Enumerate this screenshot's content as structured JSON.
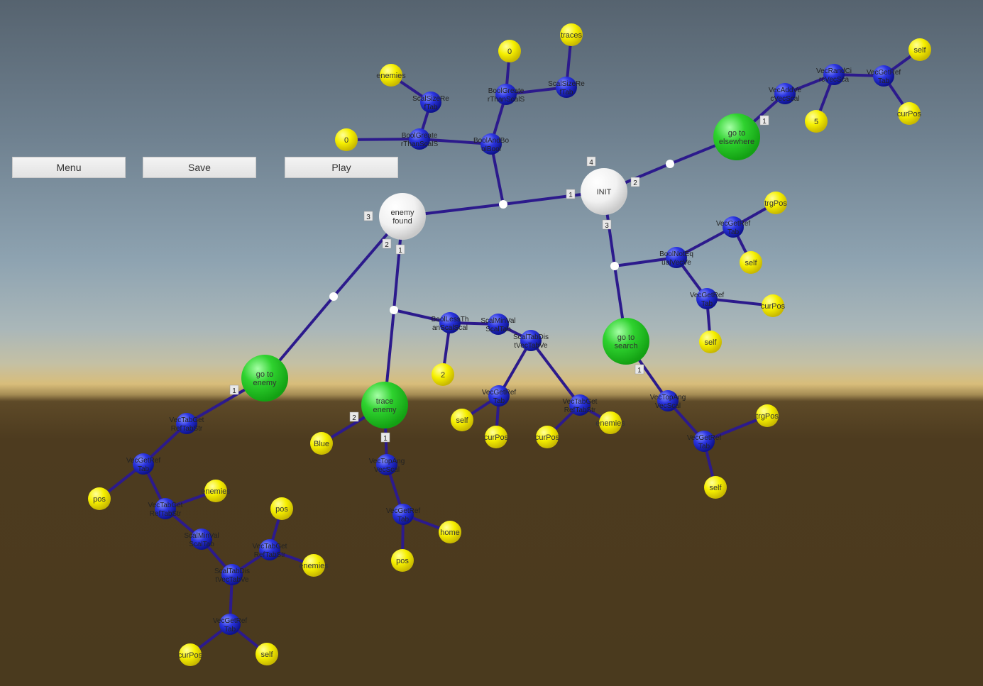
{
  "toolbar": {
    "menu_label": "Menu",
    "save_label": "Save",
    "play_label": "Play"
  },
  "states": [
    {
      "id": "init",
      "label": "INIT",
      "color": "white"
    },
    {
      "id": "enemy-found",
      "label": "enemy\nfound",
      "color": "white"
    },
    {
      "id": "go-to-elsewhere",
      "label": "go to\nelsewhere",
      "color": "green"
    },
    {
      "id": "go-to-search",
      "label": "go to\nsearch",
      "color": "green"
    },
    {
      "id": "go-to-enemy",
      "label": "go to\nenemy",
      "color": "green"
    },
    {
      "id": "trace-enemy",
      "label": "trace\nenemy",
      "color": "green"
    }
  ],
  "port_numbers": [
    "4",
    "1",
    "2",
    "3",
    "3",
    "2",
    "1",
    "1",
    "1",
    "1",
    "2",
    "1"
  ],
  "values": [
    "traces",
    "0",
    "enemies",
    "0",
    "self",
    "5",
    "curPos",
    "trgPos",
    "self",
    "curPos",
    "self",
    "trgPos",
    "self",
    "2",
    "self",
    "curPos",
    "curPos",
    "enemies",
    "Blue",
    "home",
    "pos",
    "pos",
    "enemies",
    "pos",
    "enemies",
    "curPos",
    "self"
  ],
  "operators": [
    "ScalSizeRe\nfTab",
    "BoolGreate\nrThanScalS",
    "ScalSizeRe\nfTab",
    "BoolGreate\nrThanScalS",
    "BoolAndBo\nolBool",
    "VecAddVe\ncVecScal",
    "VecRandCi\nrcVecSca",
    "VecGetRef\nTab",
    "VecGetRef\nTab",
    "BoolNotEq\nualVecVe",
    "VecGetRef\nTab",
    "BoolLessTh\nanScalScal",
    "ScalMinVal\nScalTab",
    "ScalTabDis\ntVecTabVe",
    "VecGetRef\nTab",
    "VecTabGet\nRefTabStr",
    "VecTopAng\nVecScal",
    "VecGetRef\nTab",
    "VecTabGet\nRefTabStr",
    "VecGetRef\nTab",
    "VecTabGet\nRefTabStr",
    "ScalMinVal\nScalTab",
    "VecTabGet\nRefTabStr",
    "ScalTabDis\ntVecTabVe",
    "VecGetRef\nTab",
    "VecTopAng\nVecScal",
    "VecGetRef\nTab"
  ]
}
